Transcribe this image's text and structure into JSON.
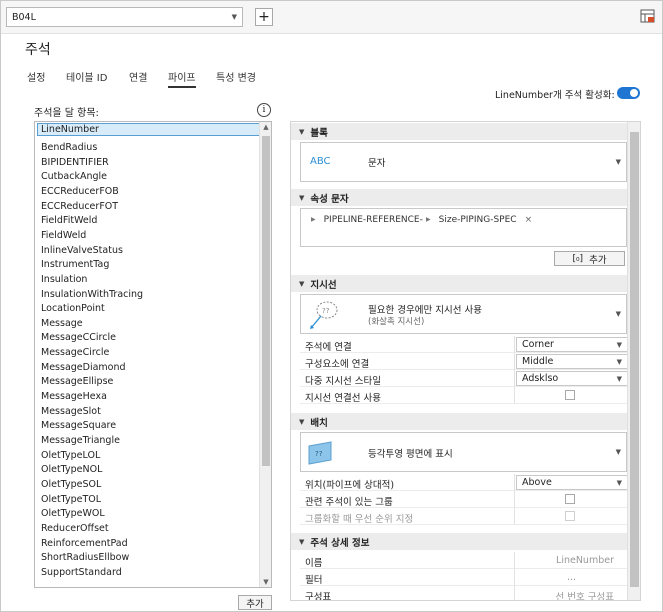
{
  "window": {
    "style_dropdown_value": "B04L",
    "add_label": "+",
    "title": "주석"
  },
  "tabs": [
    {
      "label": "설정",
      "active": false
    },
    {
      "label": "테이블 ID",
      "active": false
    },
    {
      "label": "연결",
      "active": false
    },
    {
      "label": "파이프",
      "active": true
    },
    {
      "label": "특성 변경",
      "active": false
    }
  ],
  "toggle": {
    "label": "LineNumber개 주석 활성화:",
    "on": true,
    "color": "#1f76d2"
  },
  "left": {
    "heading": "주석을 달 항목:",
    "info_icon": "info-icon",
    "selected": "LineNumber",
    "items": [
      "BendRadius",
      "BIPIDENTIFIER",
      "CutbackAngle",
      "ECCReducerFOB",
      "ECCReducerFOT",
      "FieldFitWeld",
      "FieldWeld",
      "InlineValveStatus",
      "InstrumentTag",
      "Insulation",
      "InsulationWithTracing",
      "LocationPoint",
      "Message",
      "MessageCCircle",
      "MessageCircle",
      "MessageDiamond",
      "MessageEllipse",
      "MessageHexa",
      "MessageSlot",
      "MessageSquare",
      "MessageTriangle",
      "OletTypeLOL",
      "OletTypeNOL",
      "OletTypeSOL",
      "OletTypeTOL",
      "OletTypeWOL",
      "ReducerOffset",
      "ReinforcementPad",
      "ShortRadiusEllbow",
      "SupportStandard"
    ],
    "add_button": "추가"
  },
  "sections": {
    "block": {
      "title": "블록",
      "abc_label": "ABC",
      "value": "문자"
    },
    "attr": {
      "title": "속성 문자",
      "chips": [
        "PIPELINE-REFERENCE-",
        "Size-PIPING-SPEC"
      ],
      "chip_close": "×",
      "add_button": "추가"
    },
    "leader": {
      "title": "지시선",
      "option_main": "필요한 경우에만 지시선 사용",
      "option_sub": "(화살촉 지시선)",
      "rows": [
        {
          "label": "주석에 연결",
          "value": "Corner"
        },
        {
          "label": "구성요소에 연결",
          "value": "Middle"
        },
        {
          "label": "다중 지시선 스타일",
          "value": "Adsklso"
        },
        {
          "label": "지시선 연결선 사용",
          "value": ""
        }
      ]
    },
    "placement": {
      "title": "배치",
      "option_main": "등각투영 평면에 표시",
      "rows": [
        {
          "label": "위치(파이프에 상대적)",
          "value": "Above"
        },
        {
          "label": "관련 주석이 있는 그룹",
          "value": ""
        },
        {
          "label": "그룹화할 때 우선 순위 지정",
          "value": ""
        }
      ]
    },
    "details": {
      "title": "주석 상세 정보",
      "rows": [
        {
          "label": "이름",
          "value": "LineNumber"
        },
        {
          "label": "필터",
          "value": "..."
        },
        {
          "label": "구성표",
          "value": "선 번호 구성표"
        }
      ]
    }
  }
}
